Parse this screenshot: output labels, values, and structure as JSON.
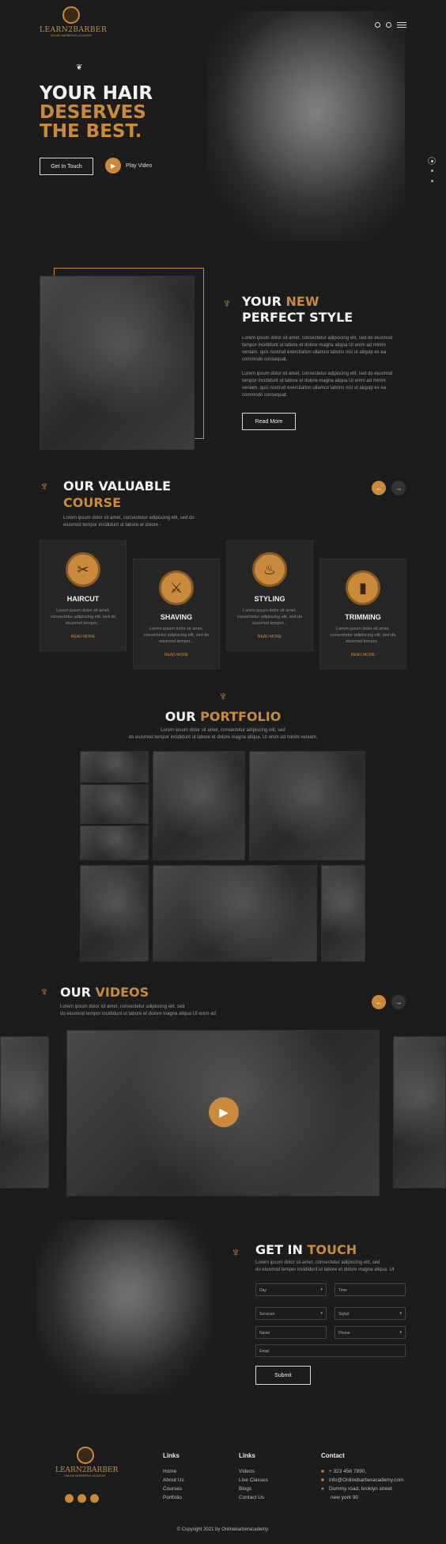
{
  "brand": {
    "name": "LEARN2BARBER",
    "tagline": "ONLINE BARBERING ACADEMY"
  },
  "hero": {
    "line1": "YOUR HAIR",
    "line2": "DESERVES",
    "line3": "THE BEST.",
    "cta": "Get In Touch",
    "play": "Play Video"
  },
  "style": {
    "title_a": "YOUR ",
    "title_b": "NEW",
    "title_c": "PERFECT STYLE",
    "p1": "Lorem ipsum dolor sit amet, consectetur adipiscing elit, sed do eiusmod tempor incididunt ut labore et dolore magna aliqua Ut enim ad minim veniam, quis nostrud exercitation ullamco laboris nisi ut aliquip ex ea commodo consequat.",
    "p2": "Lorem ipsum dolor sit amet, consectetur adipiscing elit, sed do eiusmod tempor incididunt ut labore et dolore magna aliqua Ut enim ad minim veniam, quis nostrud exercitation ullamco laboris nisi ut aliquip ex ea commodo consequat.",
    "btn": "Read More"
  },
  "course": {
    "title_a": "OUR VALUABLE",
    "title_b": "COURSE",
    "desc": "Lorem ipsum dolor sit amet, consectetur adipiscing elit, sed do eiusmod tempor incididunt ut labore et dolore -",
    "cards": [
      {
        "title": "HAIRCUT",
        "desc": "Lorem ipsum dolor sit amet, consectetur adipiscing elit, sed do eiusmod tempor...",
        "more": "READ MORE",
        "icon": "scissors-icon"
      },
      {
        "title": "SHAVING",
        "desc": "Lorem ipsum dolor sit amet, consectetur adipiscing elit, sed do eiusmod tempor...",
        "more": "READ MORE",
        "icon": "razor-icon"
      },
      {
        "title": "STYLING",
        "desc": "Lorem ipsum dolor sit amet, consectetur adipiscing elit, sed do eiusmod tempor...",
        "more": "READ MORE",
        "icon": "hairdryer-icon"
      },
      {
        "title": "TRIMMING",
        "desc": "Lorem ipsum dolor sit amet, consectetur adipiscing elit, sed do eiusmod tempor...",
        "more": "READ MORE",
        "icon": "trimmer-icon"
      }
    ]
  },
  "portfolio": {
    "title_a": "OUR ",
    "title_b": "PORTFOLIO",
    "desc1": "Lorem ipsum dolor sit amet, consectetur adipiscing elit, sed",
    "desc2": "do eiusmod tempor incididunt ut labore et dolore magna aliqua. Ut enim ad minim veniam."
  },
  "videos": {
    "title_a": "OUR ",
    "title_b": "VIDEOS",
    "desc1": "Lorem ipsum dolor sit amet, consectetur adipiscing elit, sed",
    "desc2": "do eiusmod tempor incididunt ut labore et dolore magna aliqua Ut enim ad"
  },
  "contact": {
    "title_a": "GET IN ",
    "title_b": "TOUCH",
    "desc1": "Lorem ipsum dolor sit amet, consectetur adipiscing elit, sed",
    "desc2": "do eiusmod tempor incididunt ut labore et dolore magna aliqua. Ut",
    "day": "Day",
    "time": "Time",
    "services": "Services",
    "stylist": "Stylist",
    "name": "Name",
    "phone": "Phone",
    "email": "Email",
    "submit": "Submit"
  },
  "footer": {
    "links1_title": "Links",
    "links1": [
      "Home",
      "About Us",
      "Courses",
      "Portfolio"
    ],
    "links2_title": "Links",
    "links2": [
      "Videos",
      "Live Classes",
      "Blogs",
      "Contact Us"
    ],
    "contact_title": "Contact",
    "phone": "+ 323 456 7890,",
    "email": "info@Onlinebarberacademy.com",
    "address1": "Dummy road, broklyn street",
    "address2": "new york 90",
    "copyright": "© Copyright 2021 by Onlinebarberacademy."
  },
  "colors": {
    "accent": "#c98a3c",
    "bg": "#1c1c1c"
  }
}
